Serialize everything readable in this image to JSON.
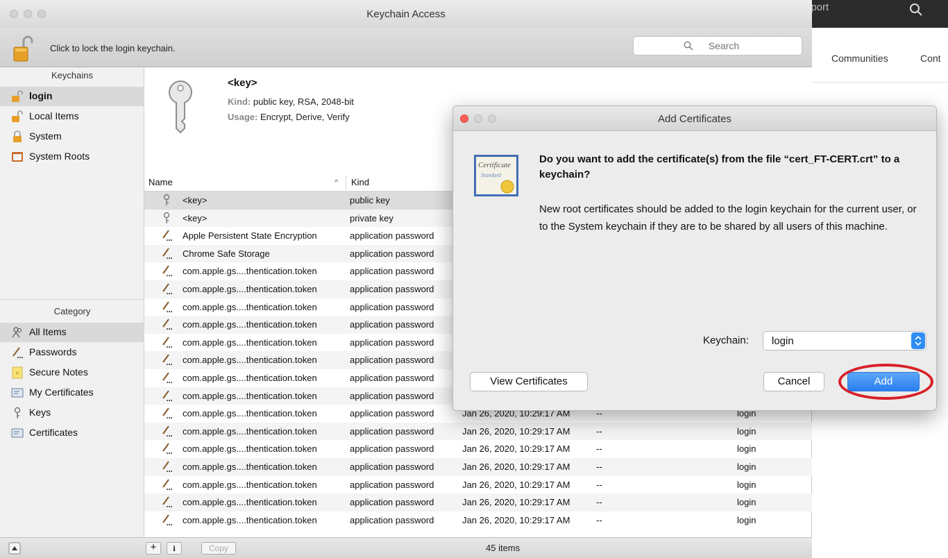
{
  "background_page": {
    "top_text": "pport",
    "nav": [
      "Communities",
      "Cont"
    ]
  },
  "window": {
    "title": "Keychain Access",
    "lock_text": "Click to lock the login keychain.",
    "search_placeholder": "Search"
  },
  "sidebar": {
    "keychains_header": "Keychains",
    "keychains": [
      {
        "label": "login",
        "icon": "unlocked-padlock-icon",
        "selected": true
      },
      {
        "label": "Local Items",
        "icon": "unlocked-padlock-icon"
      },
      {
        "label": "System",
        "icon": "locked-padlock-icon"
      },
      {
        "label": "System Roots",
        "icon": "folder-cabinet-icon"
      }
    ],
    "category_header": "Category",
    "categories": [
      {
        "label": "All Items",
        "icon": "people-icon",
        "selected": true
      },
      {
        "label": "Passwords",
        "icon": "pen-icon"
      },
      {
        "label": "Secure Notes",
        "icon": "note-icon"
      },
      {
        "label": "My Certificates",
        "icon": "certificate-icon"
      },
      {
        "label": "Keys",
        "icon": "key-icon"
      },
      {
        "label": "Certificates",
        "icon": "certificate-icon"
      }
    ]
  },
  "detail": {
    "name": "<key>",
    "kind_label": "Kind:",
    "kind_value": "public key, RSA, 2048-bit",
    "usage_label": "Usage:",
    "usage_value": "Encrypt, Derive, Verify"
  },
  "table": {
    "headers": {
      "name": "Name",
      "kind": "Kind",
      "sort_arrow": "^"
    },
    "rows": [
      {
        "name": "<key>",
        "kind": "public key",
        "date": "",
        "expires": "",
        "keychain": "",
        "icon": "key-icon",
        "selected": true
      },
      {
        "name": "<key>",
        "kind": "private key",
        "date": "",
        "expires": "",
        "keychain": "",
        "icon": "key-icon"
      },
      {
        "name": "Apple Persistent State Encryption",
        "kind": "application password",
        "date": "",
        "expires": "",
        "keychain": "",
        "icon": "pen-icon"
      },
      {
        "name": "Chrome Safe Storage",
        "kind": "application password",
        "date": "",
        "expires": "",
        "keychain": "",
        "icon": "pen-icon"
      },
      {
        "name": "com.apple.gs....thentication.token",
        "kind": "application password",
        "date": "",
        "expires": "",
        "keychain": "",
        "icon": "pen-icon"
      },
      {
        "name": "com.apple.gs....thentication.token",
        "kind": "application password",
        "date": "",
        "expires": "",
        "keychain": "",
        "icon": "pen-icon"
      },
      {
        "name": "com.apple.gs....thentication.token",
        "kind": "application password",
        "date": "",
        "expires": "",
        "keychain": "",
        "icon": "pen-icon"
      },
      {
        "name": "com.apple.gs....thentication.token",
        "kind": "application password",
        "date": "",
        "expires": "",
        "keychain": "",
        "icon": "pen-icon"
      },
      {
        "name": "com.apple.gs....thentication.token",
        "kind": "application password",
        "date": "",
        "expires": "",
        "keychain": "",
        "icon": "pen-icon"
      },
      {
        "name": "com.apple.gs....thentication.token",
        "kind": "application password",
        "date": "",
        "expires": "",
        "keychain": "",
        "icon": "pen-icon"
      },
      {
        "name": "com.apple.gs....thentication.token",
        "kind": "application password",
        "date": "",
        "expires": "",
        "keychain": "",
        "icon": "pen-icon"
      },
      {
        "name": "com.apple.gs....thentication.token",
        "kind": "application password",
        "date": "",
        "expires": "",
        "keychain": "",
        "icon": "pen-icon"
      },
      {
        "name": "com.apple.gs....thentication.token",
        "kind": "application password",
        "date": "Jan 26, 2020, 10:29:17 AM",
        "expires": "--",
        "keychain": "login",
        "icon": "pen-icon"
      },
      {
        "name": "com.apple.gs....thentication.token",
        "kind": "application password",
        "date": "Jan 26, 2020, 10:29:17 AM",
        "expires": "--",
        "keychain": "login",
        "icon": "pen-icon"
      },
      {
        "name": "com.apple.gs....thentication.token",
        "kind": "application password",
        "date": "Jan 26, 2020, 10:29:17 AM",
        "expires": "--",
        "keychain": "login",
        "icon": "pen-icon"
      },
      {
        "name": "com.apple.gs....thentication.token",
        "kind": "application password",
        "date": "Jan 26, 2020, 10:29:17 AM",
        "expires": "--",
        "keychain": "login",
        "icon": "pen-icon"
      },
      {
        "name": "com.apple.gs....thentication.token",
        "kind": "application password",
        "date": "Jan 26, 2020, 10:29:17 AM",
        "expires": "--",
        "keychain": "login",
        "icon": "pen-icon"
      },
      {
        "name": "com.apple.gs....thentication.token",
        "kind": "application password",
        "date": "Jan 26, 2020, 10:29:17 AM",
        "expires": "--",
        "keychain": "login",
        "icon": "pen-icon"
      },
      {
        "name": "com.apple.gs....thentication.token",
        "kind": "application password",
        "date": "Jan 26, 2020, 10:29:17 AM",
        "expires": "--",
        "keychain": "login",
        "icon": "pen-icon"
      }
    ]
  },
  "bottom_bar": {
    "add": "+",
    "info": "i",
    "copy": "Copy",
    "item_count": "45 items"
  },
  "dialog": {
    "title": "Add Certificates",
    "question": "Do you want to add the certificate(s) from the file “cert_FT-CERT.crt” to a keychain?",
    "message": "New root certificates should be added to the login keychain for the current user, or to the System keychain if they are to be shared by all users of this machine.",
    "keychain_label": "Keychain:",
    "keychain_value": "login",
    "view_button": "View Certificates",
    "cancel_button": "Cancel",
    "add_button": "Add",
    "certificate_icon_text": [
      "Certificate",
      "Standard"
    ]
  },
  "colors": {
    "accent": "#2a7ef0",
    "highlight_oval": "#d8202a",
    "close_red": "#fc5f57"
  }
}
